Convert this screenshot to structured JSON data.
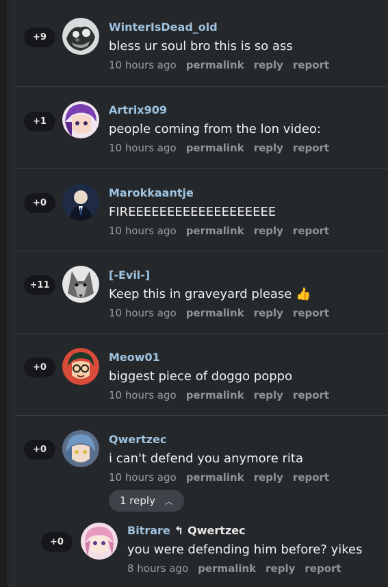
{
  "comments": [
    {
      "score": "+9",
      "avatar": "avatar-gray-monster",
      "username": "WinterIsDead_old",
      "text": "bless ur soul bro this is so ass",
      "time": "10 hours ago"
    },
    {
      "score": "+1",
      "avatar": "avatar-anime-purple-hair",
      "username": "Artrix909",
      "text": "people coming from the lon video:",
      "time": "10 hours ago"
    },
    {
      "score": "+0",
      "avatar": "avatar-man-in-suit",
      "username": "Marokkaantje",
      "text": "FIREEEEEEEEEEEEEEEEEEE",
      "time": "10 hours ago"
    },
    {
      "score": "+11",
      "avatar": "avatar-wolf",
      "username": "[-Evil-]",
      "text": "Keep this in graveyard please 👍",
      "time": "10 hours ago"
    },
    {
      "score": "+0",
      "avatar": "avatar-cartoon-glasses",
      "username": "Meow01",
      "text": "biggest piece of doggo poppo",
      "time": "10 hours ago"
    },
    {
      "score": "+0",
      "avatar": "avatar-anime-blue-hair",
      "username": "Qwertzec",
      "text": "i can't defend you anymore rita",
      "time": "10 hours ago",
      "replies_label": "1 reply"
    }
  ],
  "reply": {
    "score": "+0",
    "avatar": "avatar-anime-pink-hair",
    "username": "Bitrare",
    "reply_to": "Qwertzec",
    "text": "you were defending him before? yikes",
    "time": "8 hours ago"
  },
  "actions": {
    "permalink": "permalink",
    "reply": "reply",
    "report": "report"
  },
  "colors": {
    "background": "#25282b",
    "username": "#9fc3e0",
    "score_bg": "#15171a",
    "divider": "#3a3e42"
  }
}
